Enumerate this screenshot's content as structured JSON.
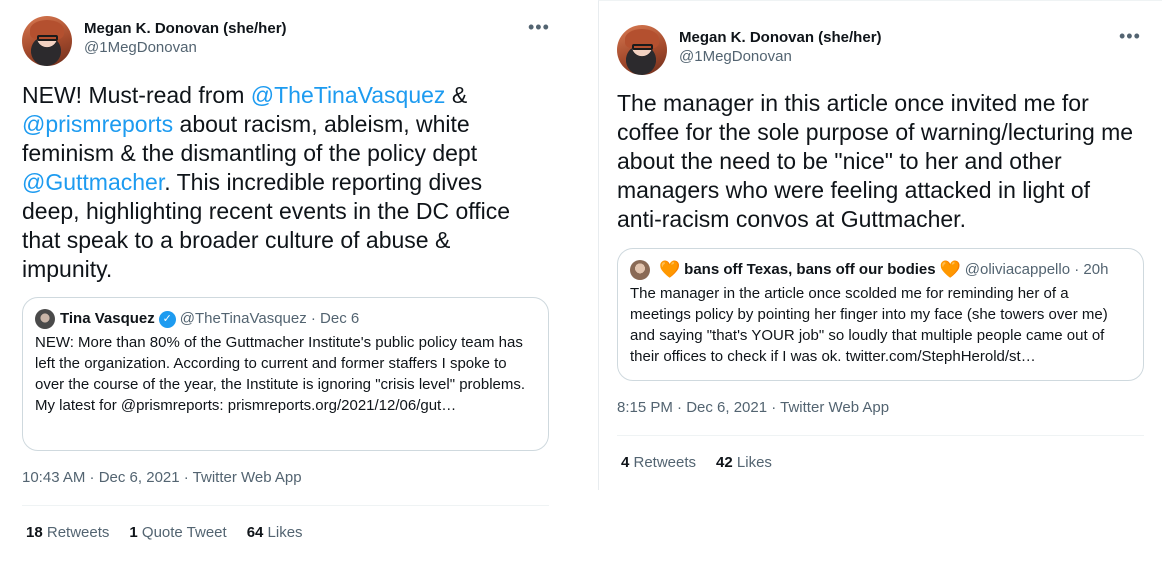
{
  "left_tweet": {
    "author": {
      "name": "Megan K. Donovan (she/her)",
      "handle": "@1MegDonovan"
    },
    "more": "•••",
    "text": {
      "t1": "NEW! Must-read from ",
      "m1": "@TheTinaVasquez",
      "t2": " & ",
      "m2": "@prismreports",
      "t3": " about racism, ableism, white feminism & the dismantling of the policy dept ",
      "m3": "@Guttmacher",
      "t4": ". This incredible reporting dives deep, highlighting recent events in the DC office that speak to a broader culture of abuse & impunity."
    },
    "quote": {
      "name": "Tina Vasquez",
      "verified": "✓",
      "meta": "@TheTinaVasquez · Dec 6",
      "text": "NEW: More than 80% of the Guttmacher Institute's public policy team has left the organization. According to current and former staffers I spoke to over the course of the year, the Institute is ignoring \"crisis level\" problems. My latest for @prismreports: prismreports.org/2021/12/06/gut…"
    },
    "timestamp": "10:43 AM · Dec 6, 2021 · Twitter Web App",
    "stats": {
      "retweets_count": "18",
      "retweets_label": " Retweets",
      "quotes_count": "1",
      "quotes_label": " Quote Tweet",
      "likes_count": "64",
      "likes_label": " Likes"
    }
  },
  "right_tweet": {
    "author": {
      "name": "Megan K. Donovan (she/her)",
      "handle": "@1MegDonovan"
    },
    "more": "•••",
    "text": "The manager in this article once invited me for coffee for the sole purpose of warning/lecturing me about the need to be \"nice\" to her and other managers who were feeling attacked in light of anti-racism convos at Guttmacher.",
    "quote": {
      "heart": "🧡",
      "name": "bans off Texas, bans off our bodies",
      "meta": "@oliviacappello · 20h",
      "text": "The manager in the article once scolded me for reminding her of a meetings policy by pointing her finger into my face (she towers over me) and saying \"that's YOUR job\" so loudly that   multiple people came out of their offices to check if I was ok. twitter.com/StephHerold/st…"
    },
    "timestamp": "8:15 PM · Dec 6, 2021 · Twitter Web App",
    "stats": {
      "retweets_count": "4",
      "retweets_label": " Retweets",
      "likes_count": "42",
      "likes_label": " Likes"
    }
  },
  "colors": {
    "link": "#1d9bf0",
    "secondary_text": "#536471",
    "primary_text": "#0f1419",
    "border": "#cfd9de",
    "heart": "#f4900c"
  }
}
